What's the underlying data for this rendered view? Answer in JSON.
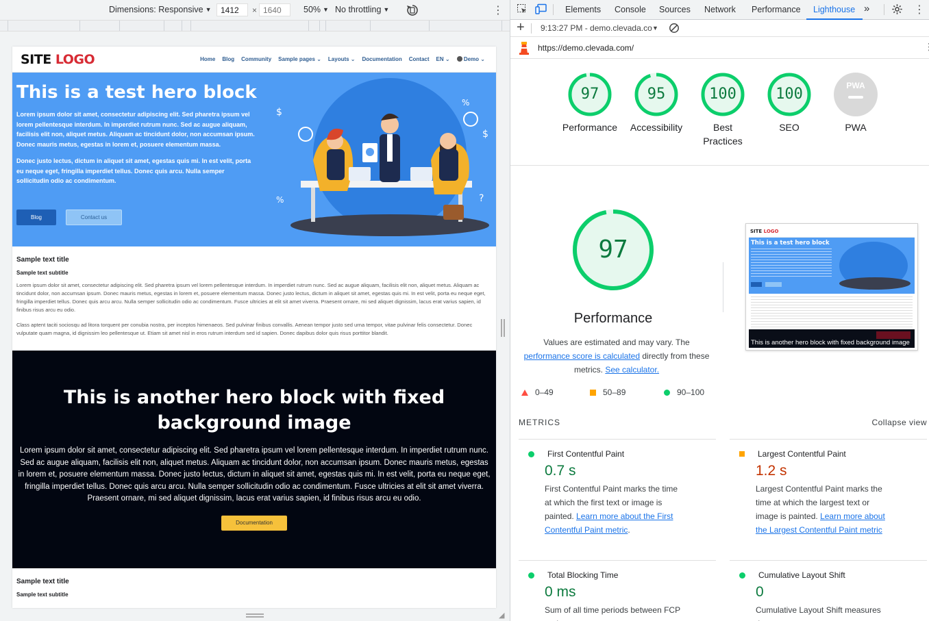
{
  "device_toolbar": {
    "dimensions_label": "Dimensions: Responsive",
    "width": "1412",
    "times": "×",
    "height": "1640",
    "zoom": "50%",
    "throttling": "No throttling"
  },
  "site": {
    "logo_part1": "SITE",
    "logo_part2": "LOGO",
    "nav": [
      "Home",
      "Blog",
      "Community",
      "Sample pages",
      "Layouts",
      "Documentation",
      "Contact",
      "EN",
      "Demo"
    ],
    "hero1": {
      "title": "This is a test hero block",
      "p1": "Lorem ipsum dolor sit amet, consectetur adipiscing elit. Sed pharetra ipsum vel lorem pellentesque interdum. In imperdiet rutrum nunc. Sed ac augue aliquam, facilisis elit non, aliquet metus. Aliquam ac tincidunt dolor, non accumsan ipsum. Donec mauris metus, egestas in lorem et, posuere elementum massa.",
      "p2": "Donec justo lectus, dictum in aliquet sit amet, egestas quis mi. In est velit, porta eu neque eget, fringilla imperdiet tellus. Donec quis arcu. Nulla semper sollicitudin odio ac condimentum.",
      "btn_blog": "Blog",
      "btn_contact": "Contact us"
    },
    "text_section": {
      "title": "Sample text title",
      "subtitle": "Sample text subtitle",
      "p1": "Lorem ipsum dolor sit amet, consectetur adipiscing elit. Sed pharetra ipsum vel lorem pellentesque interdum. In imperdiet rutrum nunc. Sed ac augue aliquam, facilisis elit non, aliquet metus. Aliquam ac tincidunt dolor, non accumsan ipsum. Donec mauris metus, egestas in lorem et, posuere elementum massa. Donec justo lectus, dictum in aliquet sit amet, egestas quis mi. In est velit, porta eu neque eget, fringilla imperdiet tellus. Donec quis arcu arcu. Nulla semper sollicitudin odio ac condimentum. Fusce ultricies at elit sit amet viverra. Praesent ornare, mi sed aliquet dignissim, lacus erat varius sapien, id finibus risus arcu eu odio.",
      "p2": "Class aptent taciti sociosqu ad litora torquent per conubia nostra, per inceptos himenaeos. Sed pulvinar finibus convallis. Aenean tempor justo sed urna tempor, vitae pulvinar felis consectetur. Donec vulputate quam magna, id dignissim leo pellentesque ut. Etiam sit amet nisl in eros rutrum interdum sed id sapien. Donec dapibus dolor quis risus porttitor blandit."
    },
    "hero2": {
      "title": "This is another hero block with fixed background image",
      "text": "Lorem ipsum dolor sit amet, consectetur adipiscing elit. Sed pharetra ipsum vel lorem pellentesque interdum. In imperdiet rutrum nunc. Sed ac augue aliquam, facilisis elit non, aliquet metus. Aliquam ac tincidunt dolor, non accumsan ipsum. Donec mauris metus, egestas in lorem et, posuere elementum massa. Donec justo lectus, dictum in aliquet sit amet, egestas quis mi. In est velit, porta eu neque eget, fringilla imperdiet tellus. Donec quis arcu arcu. Nulla semper sollicitudin odio ac condimentum. Fusce ultricies at elit sit amet viverra. Praesent ornare, mi sed aliquet dignissim, lacus erat varius sapien, id finibus risus arcu eu odio.",
      "button": "Documentation"
    },
    "section2": {
      "title": "Sample text title",
      "subtitle": "Sample text subtitle"
    }
  },
  "devtools": {
    "tabs": [
      "Elements",
      "Console",
      "Sources",
      "Network",
      "Performance",
      "Lighthouse"
    ],
    "active_tab": "Lighthouse",
    "report_time": "9:13:27 PM - demo.clevada.co",
    "url": "https://demo.clevada.com/",
    "categories": [
      {
        "score": "97",
        "label": "Performance",
        "fill": 0.97
      },
      {
        "score": "95",
        "label": "Accessibility",
        "fill": 0.95
      },
      {
        "score": "100",
        "label": "Best Practices",
        "fill": 1
      },
      {
        "score": "100",
        "label": "SEO",
        "fill": 1
      },
      {
        "score": "PWA",
        "label": "PWA",
        "fill": 0
      }
    ],
    "perf": {
      "score": "97",
      "title": "Performance",
      "text1": "Values are estimated and may vary. The",
      "link1": "performance score is calculated",
      "text2": "directly from these metrics.",
      "link2": "See calculator."
    },
    "legend": [
      "0–49",
      "50–89",
      "90–100"
    ],
    "screenshot_caption": "This is another hero block with fixed background image",
    "metrics_header": "METRICS",
    "collapse_label": "Collapse view",
    "metrics": [
      {
        "name": "First Contentful Paint",
        "value": "0.7 s",
        "status": "pass",
        "desc": "First Contentful Paint marks the time at which the first text or image is painted.",
        "link": "Learn more about the First Contentful Paint metric"
      },
      {
        "name": "Largest Contentful Paint",
        "value": "1.2 s",
        "status": "average",
        "desc": "Largest Contentful Paint marks the time at which the largest text or image is painted.",
        "link": "Learn more about the Largest Contentful Paint metric"
      },
      {
        "name": "Total Blocking Time",
        "value": "0 ms",
        "status": "pass",
        "desc": "Sum of all time periods between FCP and"
      },
      {
        "name": "Cumulative Layout Shift",
        "value": "0",
        "status": "pass",
        "desc": "Cumulative Layout Shift measures the"
      }
    ],
    "colors": {
      "pass": "#0cce6b",
      "average": "#ffa400",
      "fail": "#ff4e42",
      "link": "#1a73e8",
      "accent": "#1a73e8"
    }
  }
}
